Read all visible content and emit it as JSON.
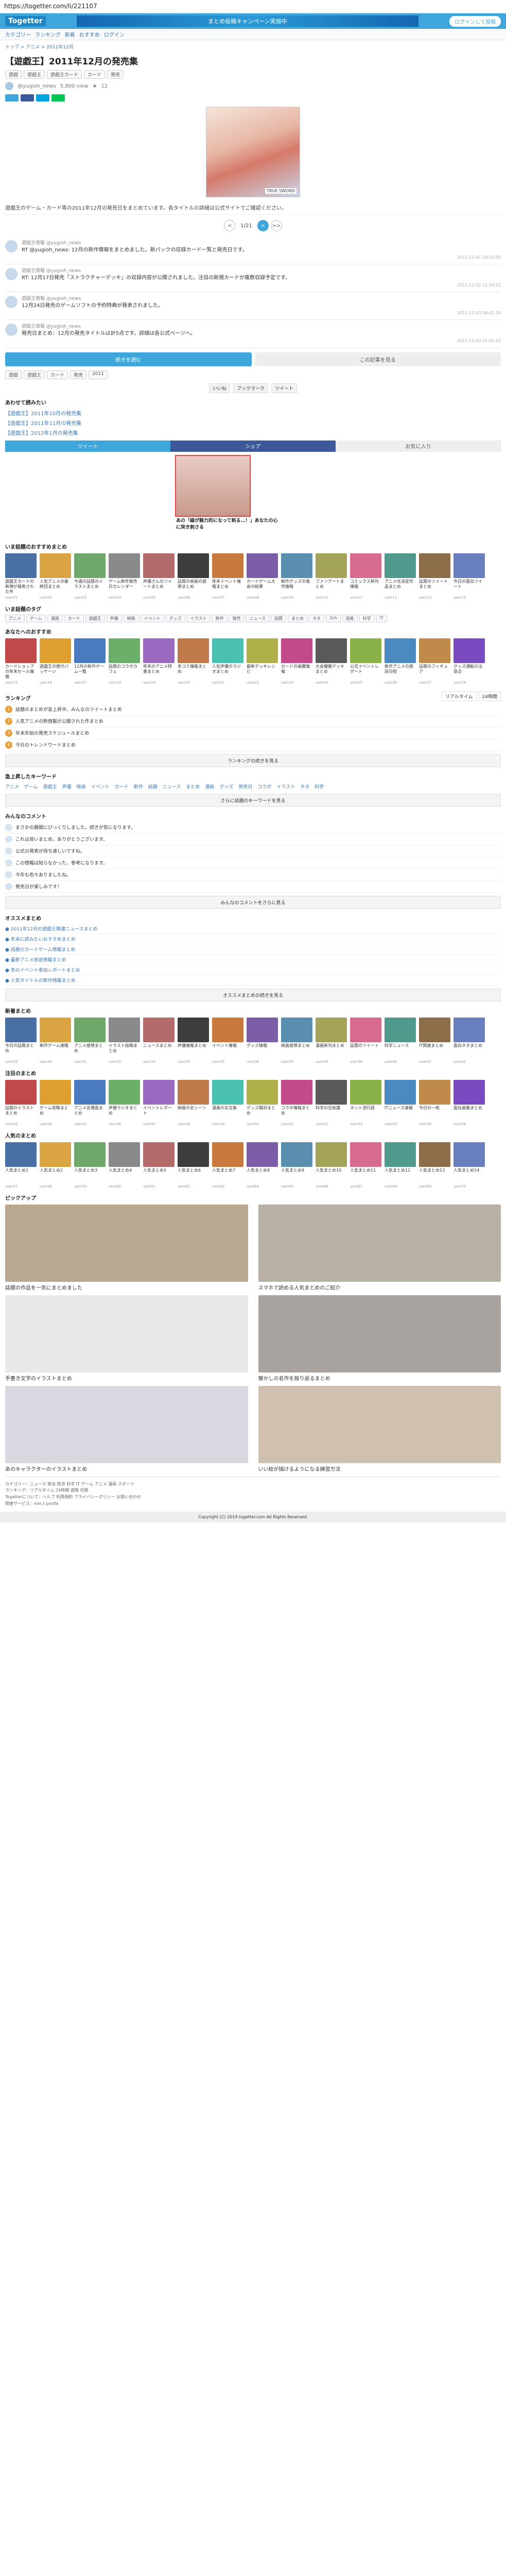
{
  "browser": {
    "url": "https://togetter.com/li/221107"
  },
  "header": {
    "logo": "Togetter",
    "banner_text": "まとめ投稿キャンペーン実施中",
    "login": "ログインして投稿",
    "subnav": [
      "カテゴリー",
      "ランキング",
      "新着",
      "おすすめ",
      "ログイン"
    ]
  },
  "article": {
    "breadcrumb": "トップ > アニメ > 2011年12月",
    "title": "【遊戯王】2011年12月の発売集",
    "tags": [
      "遊戯",
      "遊戯王",
      "遊戯王カード",
      "カード",
      "発売"
    ],
    "author": "@yugioh_news",
    "views": "5,900 view",
    "favorites": "12",
    "hero_caption": "TRUE SWORD",
    "description": "遊戯王のゲーム・カード等の2011年12月の発売日をまとめています。各タイトルの詳細は公式サイトでご確認ください。",
    "pager": {
      "prev": "<",
      "current": "1/21",
      "next": ">",
      "last": ">>"
    },
    "tweets": [
      {
        "name": "遊戯王情報 @yugioh_news",
        "text": "RT @yugioh_news: 12月の新作情報をまとめました。新パックの収録カード一覧と発売日です。",
        "time": "2011-12-01 10:11:05"
      },
      {
        "name": "遊戯王情報 @yugioh_news",
        "text": "RT: 12月17日発売「ストラクチャーデッキ」の収録内容が公開されました。注目の新規カードが複数収録予定です。",
        "time": "2011-12-02 12:14:21"
      },
      {
        "name": "遊戯王情報 @yugioh_news",
        "text": "12月24日発売のゲームソフトの予約特典が発表されました。",
        "time": "2011-12-03 08:41:10"
      },
      {
        "name": "遊戯王情報 @yugioh_news",
        "text": "発売日まとめ：12月の発売タイトルは計5点です。詳細は各公式ページへ。",
        "time": "2011-12-03 21:02:55"
      }
    ],
    "read_more": "続きを読む",
    "view_all": "この記事を見る",
    "bottom_tags": [
      "遊戯",
      "遊戯王",
      "カード",
      "発売",
      "2011"
    ],
    "stamps": [
      "いいね",
      "ブックマーク",
      "ツイート"
    ],
    "related_head": "あわせて読みたい",
    "related": [
      "【遊戯王】2011年10月の発売集",
      "【遊戯王】2011年11月の発売集",
      "【遊戯王】2012年1月の発売集"
    ],
    "share_twitter": "ツイート",
    "share_facebook": "シェア",
    "share_save": "お気に入り"
  },
  "ad": {
    "caption": "あの「線が魅力的になって刺る…！」あなたの心に突き刺さる"
  },
  "sections": {
    "popular_head": "いま話題のおすすめまとめ",
    "popular": [
      {
        "title": "遊戯王カードの新弾が発表された件",
        "user": "user01",
        "color": "#4a6fa5"
      },
      {
        "title": "人気アニメの最終回まとめ",
        "user": "user02",
        "color": "#d9a441"
      },
      {
        "title": "今週の話題のイラストまとめ",
        "user": "user03",
        "color": "#6fa86a"
      },
      {
        "title": "ゲーム新作発売日カレンダー",
        "user": "user04",
        "color": "#8a8a8a"
      },
      {
        "title": "声優さんのツイートまとめ",
        "user": "user05",
        "color": "#b36b6b"
      },
      {
        "title": "話題の映画の感想まとめ",
        "user": "user06",
        "color": "#3d3d3d"
      },
      {
        "title": "年末イベント情報まとめ",
        "user": "user07",
        "color": "#c87a3e"
      },
      {
        "title": "カードゲーム大会の結果",
        "user": "user08",
        "color": "#7b5ea7"
      },
      {
        "title": "新作グッズの発売情報",
        "user": "user09",
        "color": "#5a8fb0"
      },
      {
        "title": "ファンアートまとめ",
        "user": "user10",
        "color": "#a3a35a"
      },
      {
        "title": "コミックス新刊情報",
        "user": "user11",
        "color": "#d66a8f"
      },
      {
        "title": "アニメ化決定作品まとめ",
        "user": "user12",
        "color": "#4f9a8c"
      },
      {
        "title": "話題のツイートまとめ",
        "user": "user13",
        "color": "#8c6f4a"
      },
      {
        "title": "今日の面白ツイート",
        "user": "user14",
        "color": "#6a7fc0"
      }
    ],
    "category_head": "いま話題のタグ",
    "categories": [
      "アニメ",
      "ゲーム",
      "漫画",
      "カード",
      "遊戯王",
      "声優",
      "映画",
      "イベント",
      "グッズ",
      "イラスト",
      "新作",
      "発売",
      "ニュース",
      "話題",
      "まとめ",
      "ネタ",
      "2ch",
      "芸能",
      "科学",
      "IT"
    ],
    "recommended_head": "あなたへのおすすめ",
    "recommended": [
      {
        "title": "カードショップの年末セール情報",
        "user": "user15",
        "color": "#c04a4a"
      },
      {
        "title": "遊戯王の歴代パッケージ",
        "user": "user16",
        "color": "#e0a030"
      },
      {
        "title": "12月の新作ゲーム一覧",
        "user": "user17",
        "color": "#4a7ac0"
      },
      {
        "title": "話題のコラボカフェ",
        "user": "user18",
        "color": "#6ab06a"
      },
      {
        "title": "年末のアニメ特番まとめ",
        "user": "user19",
        "color": "#9a6ac0"
      },
      {
        "title": "冬コミ情報まとめ",
        "user": "user20",
        "color": "#c07a4a"
      },
      {
        "title": "人気声優のラジオまとめ",
        "user": "user21",
        "color": "#4ac0b0"
      },
      {
        "title": "最新デッキレシピ",
        "user": "user22",
        "color": "#b0b04a"
      },
      {
        "title": "カードの高騰情報",
        "user": "user23",
        "color": "#c04a8a"
      },
      {
        "title": "大会優勝デッキまとめ",
        "user": "user24",
        "color": "#5a5a5a"
      },
      {
        "title": "公式イベントレポート",
        "user": "user25",
        "color": "#8ab04a"
      },
      {
        "title": "新作アニメの放送日程",
        "user": "user26",
        "color": "#4a8ac0"
      },
      {
        "title": "話題のフィギュア",
        "user": "user27",
        "color": "#c08a4a"
      },
      {
        "title": "グッズ通販の注意点",
        "user": "user28",
        "color": "#7a4ac0"
      }
    ],
    "ranking_head": "ランキング",
    "ranking_tabs": [
      "リアルタイム",
      "24時間"
    ],
    "ranking": [
      "話題のまとめが急上昇中、みんなのツイートまとめ",
      "人気アニメの新情報が公開された件まとめ",
      "年末年始の発売スケジュールまとめ",
      "今日のトレンドワードまとめ"
    ],
    "ranking_more": "ランキングの続きを見る",
    "keyword_head": "急上昇したキーワード",
    "keywords": [
      "アニメ",
      "ゲーム",
      "遊戯王",
      "声優",
      "映画",
      "イベント",
      "カード",
      "新作",
      "話題",
      "ニュース",
      "まとめ",
      "漫画",
      "グッズ",
      "発売日",
      "コラボ",
      "イラスト",
      "ネタ",
      "科学"
    ],
    "keyword_more": "さらに話題のキーワードを見る",
    "comment_head": "みんなのコメント",
    "comments": [
      "まさかの展開にびっくりしました。続きが気になります。",
      "これは良いまとめ。ありがとうございます。",
      "公式の発表が待ち遠しいですね。",
      "この情報は知らなかった、参考になります。",
      "今年も色々ありましたね。",
      "発売日が楽しみです！"
    ],
    "comment_more": "みんなのコメントをさらに見る",
    "osusume_head": "オススメまとめ",
    "osusume": [
      "2011年12月の遊戯王関連ニュースまとめ",
      "年末に読みたいおすすめまとめ",
      "話題のカードゲーム情報まとめ",
      "最新アニメ放送情報まとめ",
      "冬のイベント参加レポートまとめ",
      "人気タイトルの新作情報まとめ"
    ],
    "osusume_more": "オススメまとめの続きを見る",
    "new_head": "新着まとめ",
    "new_items": [
      {
        "title": "今日の話題まとめ",
        "user": "user29",
        "color": "#4a6fa5"
      },
      {
        "title": "新作ゲーム速報",
        "user": "user30",
        "color": "#d9a441"
      },
      {
        "title": "アニメ感想まとめ",
        "user": "user31",
        "color": "#6fa86a"
      },
      {
        "title": "イラスト投稿まとめ",
        "user": "user32",
        "color": "#8a8a8a"
      },
      {
        "title": "ニュースまとめ",
        "user": "user33",
        "color": "#b36b6b"
      },
      {
        "title": "声優情報まとめ",
        "user": "user34",
        "color": "#3d3d3d"
      },
      {
        "title": "イベント情報",
        "user": "user35",
        "color": "#c87a3e"
      },
      {
        "title": "グッズ情報",
        "user": "user36",
        "color": "#7b5ea7"
      },
      {
        "title": "映画感想まとめ",
        "user": "user37",
        "color": "#5a8fb0"
      },
      {
        "title": "漫画新刊まとめ",
        "user": "user38",
        "color": "#a3a35a"
      },
      {
        "title": "話題のツイート",
        "user": "user39",
        "color": "#d66a8f"
      },
      {
        "title": "科学ニュース",
        "user": "user40",
        "color": "#4f9a8c"
      },
      {
        "title": "IT関連まとめ",
        "user": "user41",
        "color": "#8c6f4a"
      },
      {
        "title": "面白ネタまとめ",
        "user": "user42",
        "color": "#6a7fc0"
      }
    ],
    "new2_head": "注目のまとめ",
    "new2_items": [
      {
        "title": "話題のイラストまとめ",
        "user": "user43",
        "color": "#c04a4a"
      },
      {
        "title": "ゲーム攻略まとめ",
        "user": "user44",
        "color": "#e0a030"
      },
      {
        "title": "アニメ名場面まとめ",
        "user": "user45",
        "color": "#4a7ac0"
      },
      {
        "title": "声優ラジオまとめ",
        "user": "user46",
        "color": "#6ab06a"
      },
      {
        "title": "イベントレポート",
        "user": "user47",
        "color": "#9a6ac0"
      },
      {
        "title": "映画の名シーン",
        "user": "user48",
        "color": "#c07a4a"
      },
      {
        "title": "漫画の名言集",
        "user": "user49",
        "color": "#4ac0b0"
      },
      {
        "title": "グッズ開封まとめ",
        "user": "user50",
        "color": "#b0b04a"
      },
      {
        "title": "コラボ情報まとめ",
        "user": "user51",
        "color": "#c04a8a"
      },
      {
        "title": "科学の豆知識",
        "user": "user52",
        "color": "#5a5a5a"
      },
      {
        "title": "ネット流行語",
        "user": "user53",
        "color": "#8ab04a"
      },
      {
        "title": "ITニュース速報",
        "user": "user54",
        "color": "#4a8ac0"
      },
      {
        "title": "今日の一枚",
        "user": "user55",
        "color": "#c08a4a"
      },
      {
        "title": "面白画像まとめ",
        "user": "user56",
        "color": "#7a4ac0"
      }
    ],
    "new3_head": "人気のまとめ",
    "new3_items": [
      {
        "title": "人気まとめ1",
        "user": "user57",
        "color": "#4a6fa5"
      },
      {
        "title": "人気まとめ2",
        "user": "user58",
        "color": "#d9a441"
      },
      {
        "title": "人気まとめ3",
        "user": "user59",
        "color": "#6fa86a"
      },
      {
        "title": "人気まとめ4",
        "user": "user60",
        "color": "#8a8a8a"
      },
      {
        "title": "人気まとめ5",
        "user": "user61",
        "color": "#b36b6b"
      },
      {
        "title": "人気まとめ6",
        "user": "user62",
        "color": "#3d3d3d"
      },
      {
        "title": "人気まとめ7",
        "user": "user63",
        "color": "#c87a3e"
      },
      {
        "title": "人気まとめ8",
        "user": "user64",
        "color": "#7b5ea7"
      },
      {
        "title": "人気まとめ9",
        "user": "user65",
        "color": "#5a8fb0"
      },
      {
        "title": "人気まとめ10",
        "user": "user66",
        "color": "#a3a35a"
      },
      {
        "title": "人気まとめ11",
        "user": "user67",
        "color": "#d66a8f"
      },
      {
        "title": "人気まとめ12",
        "user": "user68",
        "color": "#4f9a8c"
      },
      {
        "title": "人気まとめ13",
        "user": "user69",
        "color": "#8c6f4a"
      },
      {
        "title": "人気まとめ14",
        "user": "user70",
        "color": "#6a7fc0"
      }
    ],
    "big_head": "ピックアップ",
    "big": [
      {
        "title": "話題の作品を一気にまとめました",
        "color": "#b8a890"
      },
      {
        "title": "スマホで読める人気まとめのご紹介",
        "color": "#b9b0a6"
      },
      {
        "title": "手書き文字のイラストまとめ",
        "color": "#e8e8e8"
      },
      {
        "title": "懐かしの名作を振り返るまとめ",
        "color": "#a9a3a0"
      },
      {
        "title": "あのキャラクターのイラストまとめ",
        "color": "#d8d8e0"
      },
      {
        "title": "いい絵が描けるようになる練習方法",
        "color": "#d0c0b0"
      }
    ]
  },
  "footer": {
    "lines": [
      "カテゴリー：ニュース 政治 経済 科学 IT ゲーム アニメ 漫画 スポーツ",
      "ランキング：リアルタイム 24時間 週間 月間",
      "Togetterについて：ヘルプ 利用規約 プライバシーポリシー お問い合わせ",
      "関連サービス：min.t posfie"
    ],
    "copyright": "Copyright (C) 2019 togetter.com All Rights Reserved."
  }
}
